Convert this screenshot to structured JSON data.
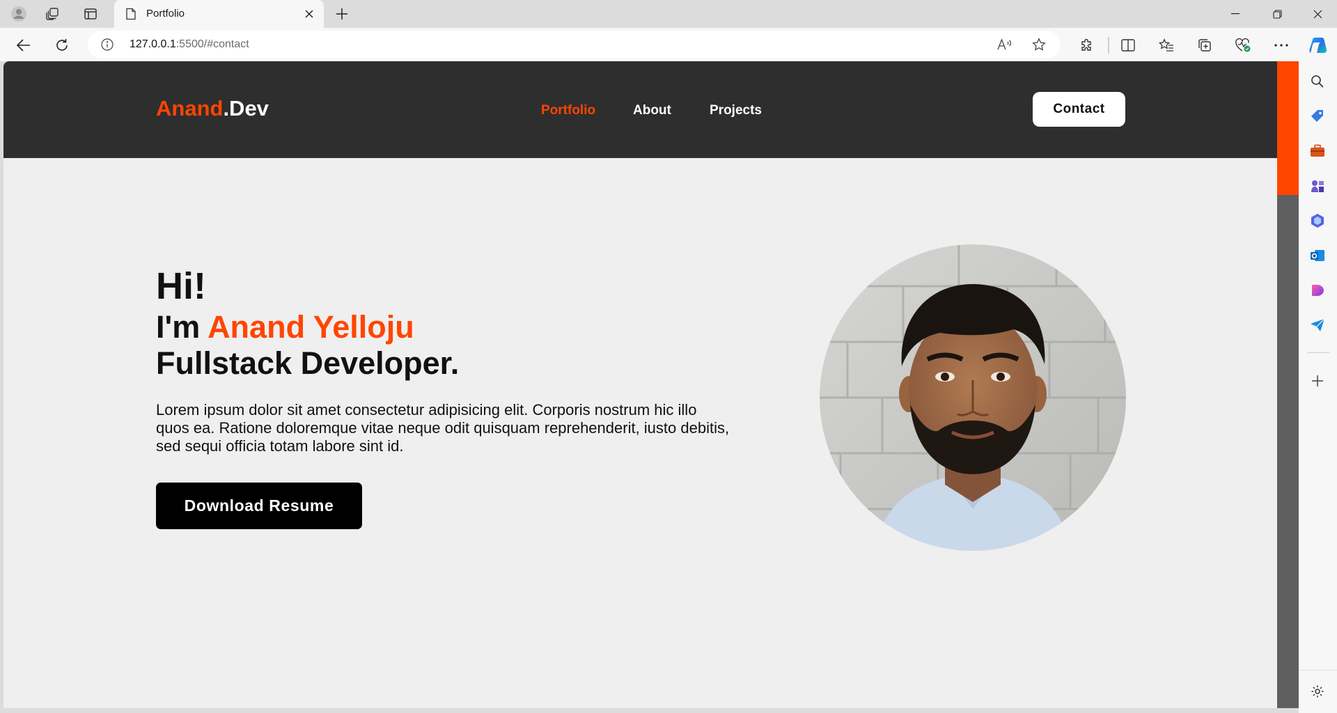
{
  "browser": {
    "tab_title": "Portfolio",
    "url_host": "127.0.0.1",
    "url_rest": ":5500/#contact",
    "icons": {
      "profile": "profile-icon",
      "workspaces": "workspaces-icon",
      "tab_actions": "tab-actions-icon",
      "page": "page-icon",
      "close": "close-icon",
      "new_tab": "plus-icon",
      "back": "back-arrow-icon",
      "refresh": "refresh-icon",
      "info": "info-icon",
      "read_aloud": "read-aloud-icon",
      "favorite": "star-icon",
      "extensions": "puzzle-icon",
      "split": "split-screen-icon",
      "favorites": "favorites-icon",
      "collections": "collections-icon",
      "health": "browser-essentials-icon",
      "more": "more-icon",
      "copilot": "copilot-icon"
    }
  },
  "site": {
    "logo_accent": "Anand",
    "logo_rest": ".Dev",
    "nav": [
      {
        "label": "Portfolio",
        "active": true
      },
      {
        "label": "About",
        "active": false
      },
      {
        "label": "Projects",
        "active": false
      }
    ],
    "contact_label": "Contact",
    "hero": {
      "greeting": "Hi!",
      "intro_prefix": "I'm ",
      "name": "Anand Yelloju",
      "role": "Fullstack Developer.",
      "description": "Lorem ipsum dolor sit amet consectetur adipisicing elit. Corporis nostrum hic illo quos ea. Ratione doloremque vitae neque odit quisquam reprehenderit, iusto debitis, sed sequi officia totam labore sint id.",
      "button_label": "Download Resume"
    },
    "colors": {
      "accent": "#ff4500",
      "header_bg": "#2e2e2e",
      "page_bg": "#efefef"
    }
  },
  "sidebar_icons": [
    "search-icon",
    "tag-icon",
    "toolbox-icon",
    "games-icon",
    "office-icon",
    "outlook-icon",
    "designer-icon",
    "send-icon",
    "add-icon",
    "settings-icon"
  ]
}
